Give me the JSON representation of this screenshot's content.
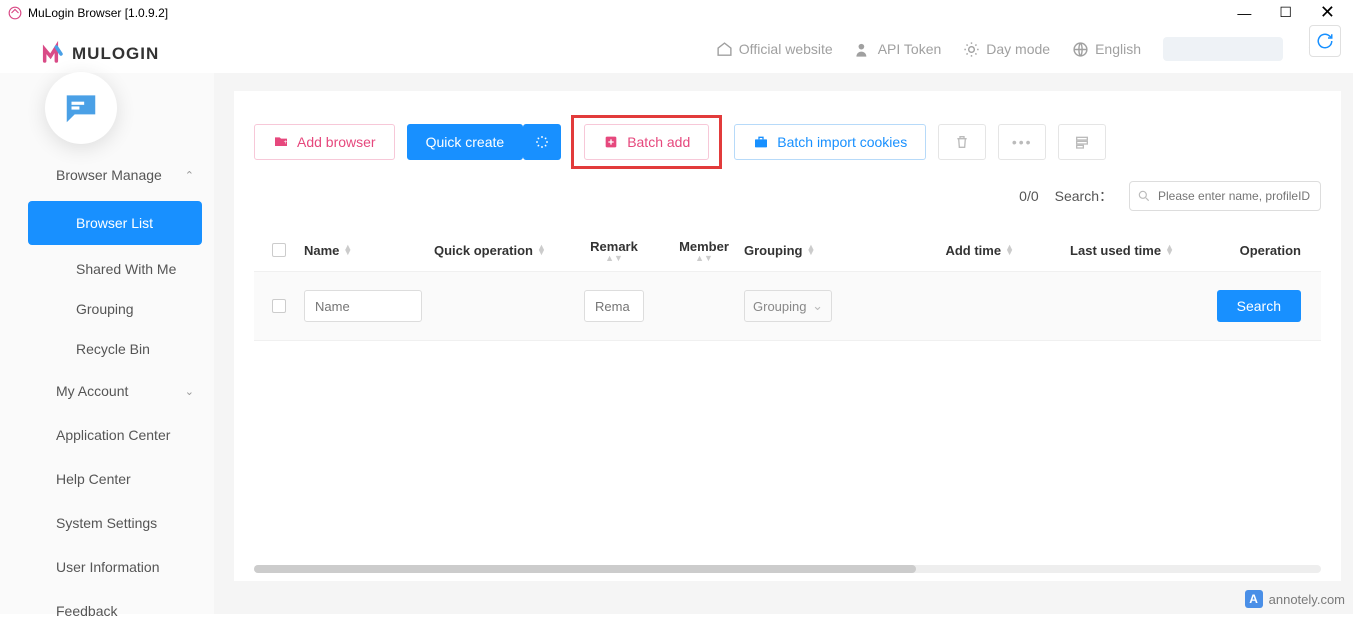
{
  "titlebar": {
    "title": "MuLogin Browser  [1.0.9.2]"
  },
  "logo": {
    "text": "MULOGIN"
  },
  "topnav": {
    "official": "Official website",
    "api": "API Token",
    "daymode": "Day mode",
    "language": "English"
  },
  "sidebar": {
    "browserManage": "Browser Manage",
    "browserList": "Browser List",
    "sharedWithMe": "Shared With Me",
    "grouping": "Grouping",
    "recycleBin": "Recycle Bin",
    "myAccount": "My Account",
    "appCenter": "Application Center",
    "helpCenter": "Help Center",
    "systemSettings": "System Settings",
    "userInfo": "User Information",
    "feedback": "Feedback"
  },
  "toolbar": {
    "addBrowser": "Add browser",
    "quickCreate": "Quick create",
    "batchAdd": "Batch add",
    "batchImport": "Batch import cookies"
  },
  "searchRow": {
    "count": "0/0",
    "label": "Search：",
    "placeholder": "Please enter name, profileID"
  },
  "table": {
    "headers": {
      "name": "Name",
      "quick": "Quick operation",
      "remark": "Remark",
      "member": "Member",
      "grouping": "Grouping",
      "addtime": "Add time",
      "lastused": "Last used time",
      "operation": "Operation"
    },
    "filter": {
      "namePh": "Name",
      "remarkPh": "Rema",
      "groupingLabel": "Grouping",
      "searchBtn": "Search"
    }
  },
  "watermark": "annotely.com"
}
